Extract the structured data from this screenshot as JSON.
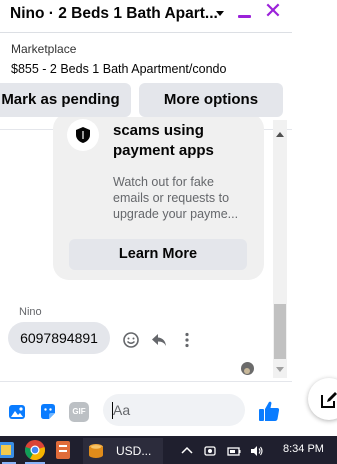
{
  "header": {
    "title": "Nino · 2 Beds 1 Bath Apart...",
    "minimize_icon": "minimize-icon",
    "close_glyph": "✕"
  },
  "marketplace": {
    "label": "Marketplace",
    "listing": "$855 - 2 Beds 1 Bath Apartment/condo",
    "mark_pending_label": "Mark as pending",
    "more_options_label": "More options"
  },
  "scam_card": {
    "icon": "shield-icon",
    "heading": "Beware of common scams using payment apps",
    "body": "Watch out for fake emails or requests to upgrade your payme...",
    "learn_more_label": "Learn More"
  },
  "message": {
    "sender": "Nino",
    "text": "6097894891",
    "actions": [
      "emoji-react-icon",
      "reply-icon",
      "more-dots-icon"
    ]
  },
  "composer": {
    "placeholder": "Aa",
    "icons": [
      "photo-icon",
      "sticker-icon",
      "gif-icon",
      "emoji-icon",
      "like-icon"
    ],
    "gif_text": "GIF"
  },
  "taskbar": {
    "usd_label": "USD...",
    "time": "8:34 PM",
    "apps": [
      "windows-app-icon",
      "chrome-icon",
      "app-icon"
    ],
    "tray": [
      "chevron-up-icon",
      "camera-icon",
      "battery-icon",
      "volume-icon"
    ]
  },
  "colors": {
    "accent": "#9b22d9",
    "messenger_blue": "#0a7cff",
    "bubble": "#e4e6eb",
    "card": "#f0f0f0",
    "taskbar": "#1f1f2e"
  }
}
